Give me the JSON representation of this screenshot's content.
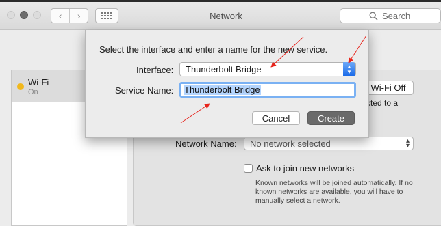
{
  "window": {
    "title": "Network",
    "search_placeholder": "Search"
  },
  "sidebar": {
    "items": [
      {
        "name": "Wi-Fi",
        "status": "On",
        "status_color": "#f1b81c"
      }
    ]
  },
  "main": {
    "wifi_off_label": "Wi-Fi Off",
    "connected_text": "cted to a",
    "network_name_label": "Network Name:",
    "network_name_value": "No network selected",
    "ask_label": "Ask to join new networks",
    "ask_description": "Known networks will be joined automatically. If no known networks are available, you will have to manually select a network."
  },
  "dialog": {
    "message": "Select the interface and enter a name for the new service.",
    "interface_label": "Interface:",
    "interface_value": "Thunderbolt Bridge",
    "service_name_label": "Service Name:",
    "service_name_value": "Thunderbolt Bridge",
    "cancel_label": "Cancel",
    "create_label": "Create"
  },
  "colors": {
    "accent": "#1768e8",
    "selection": "#b3d4fd",
    "annotation_arrow": "#e8241c"
  }
}
